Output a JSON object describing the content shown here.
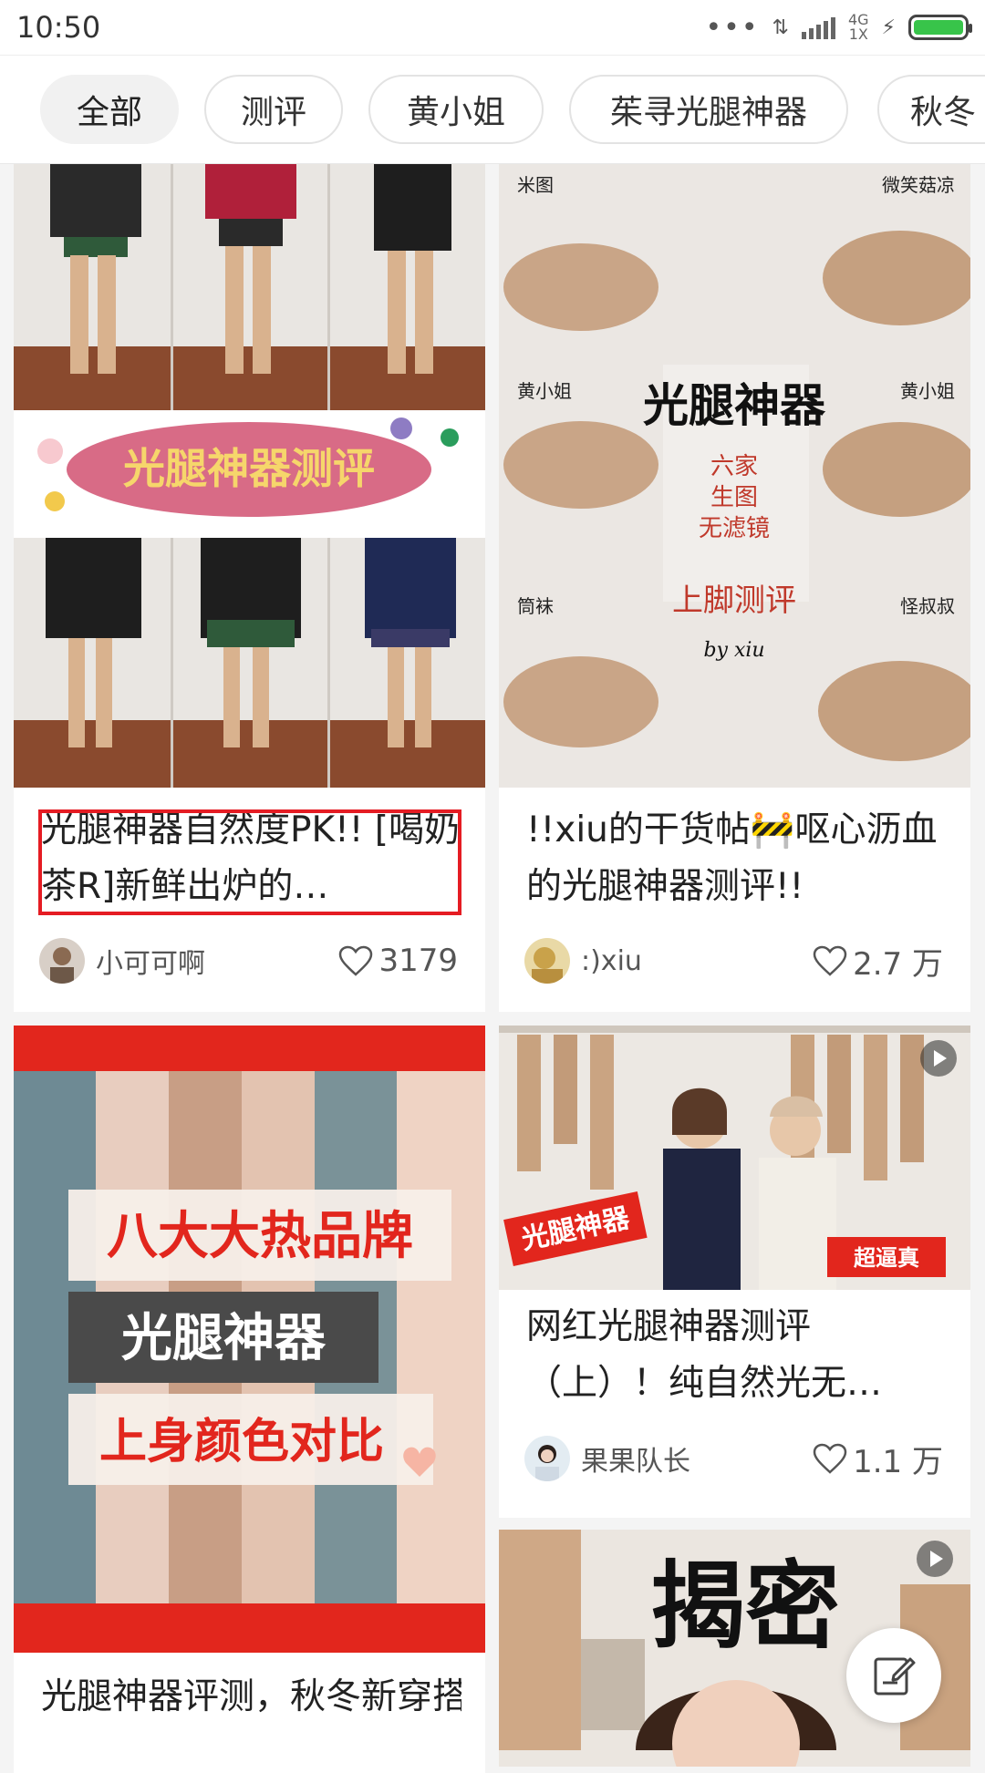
{
  "status_bar": {
    "time": "10:50",
    "network": "4G",
    "network_sub": "1X"
  },
  "tabs": [
    {
      "label": "全部"
    },
    {
      "label": "测评"
    },
    {
      "label": "黄小姐"
    },
    {
      "label": "茱寻光腿神器"
    },
    {
      "label": "秋冬"
    }
  ],
  "cards": [
    {
      "title": "光腿神器自然度PK!! [喝奶茶R]新鲜出炉的…",
      "banner": "光腿神器测评",
      "author": "小可可啊",
      "likes": "3179"
    },
    {
      "title": "!!xiu的干货帖🚧呕心沥血的光腿神器测评!!",
      "img_title": "光腿神器",
      "img_sub": [
        "六家",
        "生图",
        "无滤镜"
      ],
      "img_bottom": "上脚测评",
      "img_by": "by xiu",
      "img_labels": [
        "米图",
        "微笑菇凉",
        "黄小姐",
        "黄小姐",
        "筒袜",
        "怪叔叔"
      ],
      "author": ":)xiu",
      "likes": "2.7 万"
    },
    {
      "img_lines": [
        "八大大热品牌",
        "光腿神器",
        "上身颜色对比"
      ],
      "title": "光腿神器评测，秋冬新穿搭双上，攻略!"
    },
    {
      "title": "网红光腿神器测评（上）！纯自然光无…",
      "img_tag_left": "光腿神器",
      "img_tag_right": "超逼真",
      "author": "果果队长",
      "likes": "1.1 万"
    },
    {
      "img_title": "揭密"
    }
  ]
}
